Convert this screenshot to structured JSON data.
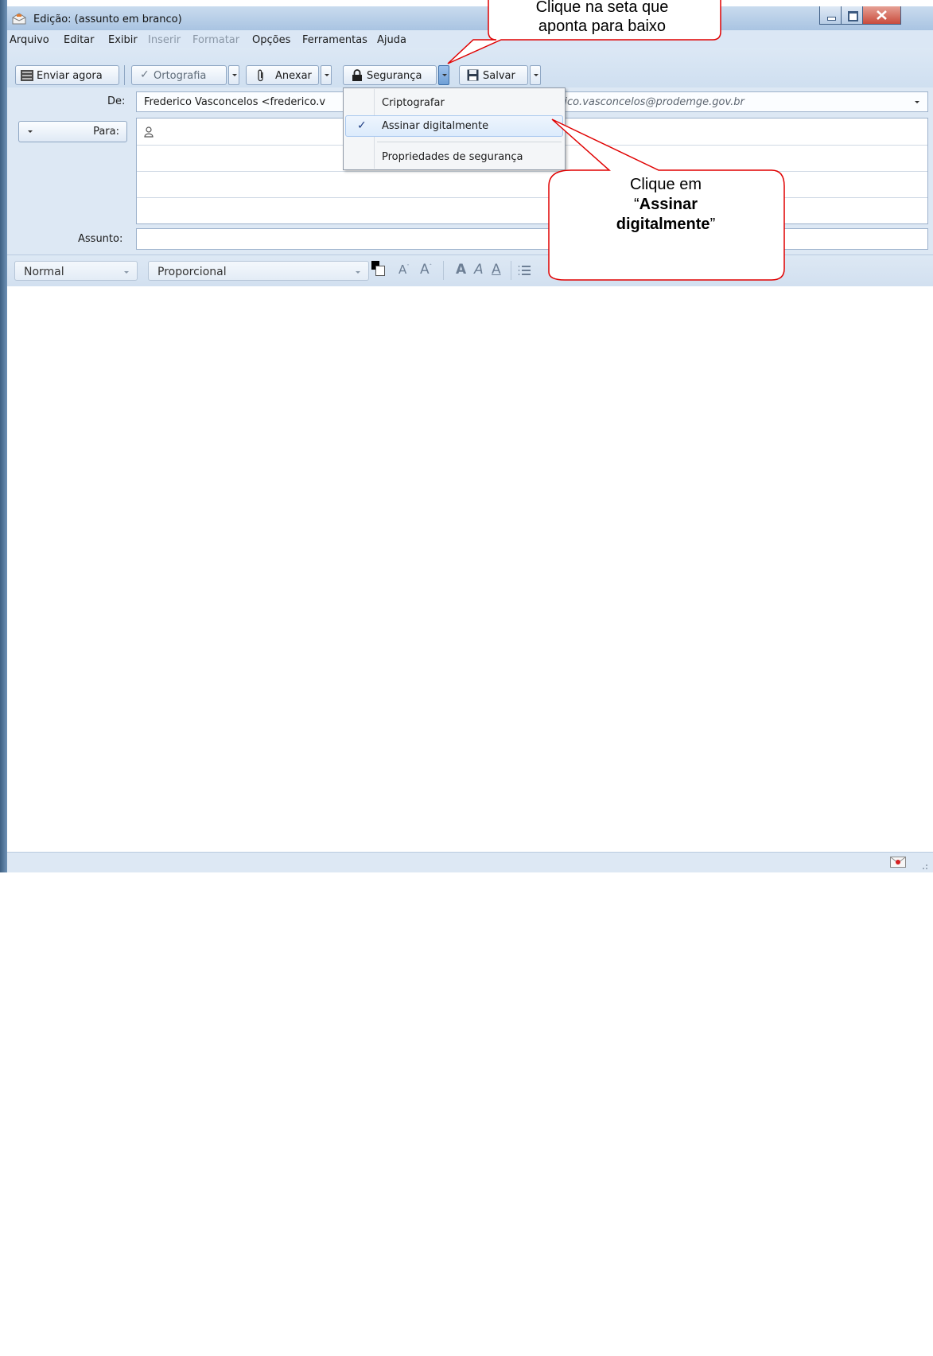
{
  "window": {
    "title": "Edição: (assunto em branco)"
  },
  "menubar": {
    "items": [
      {
        "label": "Arquivo",
        "disabled": false
      },
      {
        "label": "Editar",
        "disabled": false
      },
      {
        "label": "Exibir",
        "disabled": false
      },
      {
        "label": "Inserir",
        "disabled": true
      },
      {
        "label": "Formatar",
        "disabled": true
      },
      {
        "label": "Opções",
        "disabled": false
      },
      {
        "label": "Ferramentas",
        "disabled": false
      },
      {
        "label": "Ajuda",
        "disabled": false
      }
    ]
  },
  "toolbar": {
    "send_label": "Enviar agora",
    "spelling_label": "Ortografia",
    "attach_label": "Anexar",
    "security_label": "Segurança",
    "save_label": "Salvar"
  },
  "header": {
    "from_label": "De:",
    "from_value": "Frederico Vasconcelos <frederico.v",
    "from_value_tail": "rico.vasconcelos@prodemge.gov.br",
    "to_label": "Para:",
    "subject_label": "Assunto:"
  },
  "security_menu": {
    "items": [
      {
        "label": "Criptografar",
        "checked": false
      },
      {
        "label": "Assinar digitalmente",
        "checked": true
      },
      {
        "label": "Propriedades de segurança",
        "checked": false
      }
    ]
  },
  "format_bar": {
    "paragraph_style": "Normal",
    "font_family": "Proporcional"
  },
  "callouts": {
    "top_line1": "Clique na seta que",
    "top_line2": "aponta para baixo",
    "bottom_line1": "Clique em",
    "bottom_bold1": "Assinar",
    "bottom_bold2": "digitalmente"
  },
  "colors": {
    "callout_border": "#e00000",
    "titlebar": "#b7cde6",
    "close_button": "#c94a3c",
    "menu_selection": "#dcebfc"
  },
  "icons": [
    "email-edit-icon",
    "send-icon",
    "check-icon",
    "paperclip-icon",
    "lock-icon",
    "floppy-disk-icon",
    "contact-icon",
    "status-icon"
  ]
}
